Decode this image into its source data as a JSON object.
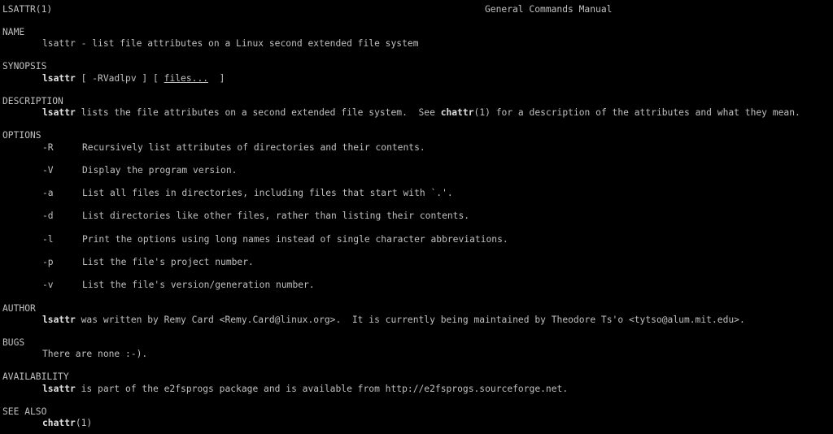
{
  "header": {
    "left": "LSATTR(1)",
    "center": "General Commands Manual"
  },
  "sections": {
    "name": {
      "heading": "NAME",
      "cmd": "lsattr",
      "text": " - list file attributes on a Linux second extended file system"
    },
    "synopsis": {
      "heading": "SYNOPSIS",
      "cmd": "lsattr",
      "pre": " [ -RVadlpv ] [ ",
      "arg": "files...",
      "post": "  ]"
    },
    "description": {
      "heading": "DESCRIPTION",
      "cmd": "lsattr",
      "text": " lists the file attributes on a second extended file system.  See ",
      "ref": "chattr",
      "ref_tail": "(1) for a description of the attributes and what they mean."
    },
    "options": {
      "heading": "OPTIONS",
      "items": [
        {
          "flag": "-R",
          "text": "Recursively list attributes of directories and their contents."
        },
        {
          "flag": "-V",
          "text": "Display the program version."
        },
        {
          "flag": "-a",
          "text": "List all files in directories, including files that start with `.'."
        },
        {
          "flag": "-d",
          "text": "List directories like other files, rather than listing their contents."
        },
        {
          "flag": "-l",
          "text": "Print the options using long names instead of single character abbreviations."
        },
        {
          "flag": "-p",
          "text": "List the file's project number."
        },
        {
          "flag": "-v",
          "text": "List the file's version/generation number."
        }
      ]
    },
    "author": {
      "heading": "AUTHOR",
      "cmd": "lsattr",
      "text": " was written by Remy Card <Remy.Card@linux.org>.  It is currently being maintained by Theodore Ts'o <tytso@alum.mit.edu>."
    },
    "bugs": {
      "heading": "BUGS",
      "text": "There are none :-)."
    },
    "availability": {
      "heading": "AVAILABILITY",
      "cmd": "lsattr",
      "text": " is part of the e2fsprogs package and is available from http://e2fsprogs.sourceforge.net."
    },
    "see_also": {
      "heading": "SEE ALSO",
      "cmd": "chattr",
      "tail": "(1)"
    }
  },
  "colors": {
    "background": "#000000",
    "text": "#c0c0c0",
    "bold": "#e0e0e0"
  }
}
